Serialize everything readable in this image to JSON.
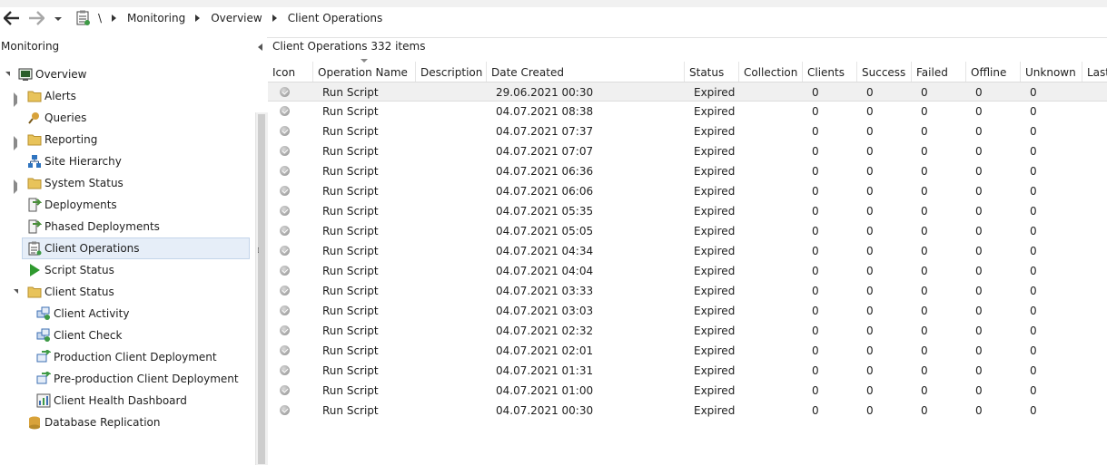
{
  "breadcrumb": {
    "root": "\\",
    "items": [
      "Monitoring",
      "Overview",
      "Client Operations"
    ]
  },
  "left": {
    "title": "Monitoring",
    "tree": [
      {
        "label": "Overview",
        "level": 0,
        "expander": "open",
        "icon": "overview-icon",
        "icon_color": "#2b5f2b"
      },
      {
        "label": "Alerts",
        "level": 1,
        "expander": "closed",
        "icon": "folder-icon",
        "icon_color": "#e8c35a"
      },
      {
        "label": "Queries",
        "level": 1,
        "expander": "none",
        "icon": "query-icon",
        "icon_color": "#d8a23a"
      },
      {
        "label": "Reporting",
        "level": 1,
        "expander": "closed",
        "icon": "folder-icon",
        "icon_color": "#e8c35a"
      },
      {
        "label": "Site Hierarchy",
        "level": 1,
        "expander": "none",
        "icon": "hierarchy-icon",
        "icon_color": "#2f74c0"
      },
      {
        "label": "System Status",
        "level": 1,
        "expander": "closed",
        "icon": "folder-icon",
        "icon_color": "#e8c35a"
      },
      {
        "label": "Deployments",
        "level": 1,
        "expander": "none",
        "icon": "deployment-icon",
        "icon_color": "#4a8f3a"
      },
      {
        "label": "Phased Deployments",
        "level": 1,
        "expander": "none",
        "icon": "phased-deployment-icon",
        "icon_color": "#4a8f3a"
      },
      {
        "label": "Client Operations",
        "level": 1,
        "expander": "none",
        "icon": "client-operations-icon",
        "icon_color": "#4a4a4a",
        "selected": true
      },
      {
        "label": "Script Status",
        "level": 1,
        "expander": "none",
        "icon": "play-icon",
        "icon_color": "#2f9a2f"
      },
      {
        "label": "Client Status",
        "level": 1,
        "expander": "open",
        "icon": "folder-icon",
        "icon_color": "#e8c35a"
      },
      {
        "label": "Client Activity",
        "level": 2,
        "expander": "none",
        "icon": "client-activity-icon",
        "icon_color": "#3d6fb3"
      },
      {
        "label": "Client Check",
        "level": 2,
        "expander": "none",
        "icon": "client-check-icon",
        "icon_color": "#3d6fb3"
      },
      {
        "label": "Production Client Deployment",
        "level": 2,
        "expander": "none",
        "icon": "client-deployment-icon",
        "icon_color": "#3e9a46"
      },
      {
        "label": "Pre-production Client Deployment",
        "level": 2,
        "expander": "none",
        "icon": "client-deployment-icon",
        "icon_color": "#3e9a46"
      },
      {
        "label": "Client Health Dashboard",
        "level": 2,
        "expander": "none",
        "icon": "dashboard-icon",
        "icon_color": "#3d6fb3"
      },
      {
        "label": "Database Replication",
        "level": 1,
        "expander": "none",
        "icon": "database-icon",
        "icon_color": "#d8a23a"
      }
    ]
  },
  "main": {
    "title": "Client Operations",
    "count": "332 items",
    "columns": [
      "Icon",
      "Operation Name",
      "Description",
      "Date Created",
      "Status",
      "Collection",
      "Clients",
      "Success",
      "Failed",
      "Offline",
      "Unknown",
      "Last"
    ],
    "rows": [
      {
        "op": "Run Script",
        "date": "29.06.2021 00:30",
        "status": "Expired",
        "clients": "0",
        "success": "0",
        "failed": "0",
        "offline": "0",
        "unknown": "0"
      },
      {
        "op": "Run Script",
        "date": "04.07.2021 08:38",
        "status": "Expired",
        "clients": "0",
        "success": "0",
        "failed": "0",
        "offline": "0",
        "unknown": "0"
      },
      {
        "op": "Run Script",
        "date": "04.07.2021 07:37",
        "status": "Expired",
        "clients": "0",
        "success": "0",
        "failed": "0",
        "offline": "0",
        "unknown": "0"
      },
      {
        "op": "Run Script",
        "date": "04.07.2021 07:07",
        "status": "Expired",
        "clients": "0",
        "success": "0",
        "failed": "0",
        "offline": "0",
        "unknown": "0"
      },
      {
        "op": "Run Script",
        "date": "04.07.2021 06:36",
        "status": "Expired",
        "clients": "0",
        "success": "0",
        "failed": "0",
        "offline": "0",
        "unknown": "0"
      },
      {
        "op": "Run Script",
        "date": "04.07.2021 06:06",
        "status": "Expired",
        "clients": "0",
        "success": "0",
        "failed": "0",
        "offline": "0",
        "unknown": "0"
      },
      {
        "op": "Run Script",
        "date": "04.07.2021 05:35",
        "status": "Expired",
        "clients": "0",
        "success": "0",
        "failed": "0",
        "offline": "0",
        "unknown": "0"
      },
      {
        "op": "Run Script",
        "date": "04.07.2021 05:05",
        "status": "Expired",
        "clients": "0",
        "success": "0",
        "failed": "0",
        "offline": "0",
        "unknown": "0"
      },
      {
        "op": "Run Script",
        "date": "04.07.2021 04:34",
        "status": "Expired",
        "clients": "0",
        "success": "0",
        "failed": "0",
        "offline": "0",
        "unknown": "0"
      },
      {
        "op": "Run Script",
        "date": "04.07.2021 04:04",
        "status": "Expired",
        "clients": "0",
        "success": "0",
        "failed": "0",
        "offline": "0",
        "unknown": "0"
      },
      {
        "op": "Run Script",
        "date": "04.07.2021 03:33",
        "status": "Expired",
        "clients": "0",
        "success": "0",
        "failed": "0",
        "offline": "0",
        "unknown": "0"
      },
      {
        "op": "Run Script",
        "date": "04.07.2021 03:03",
        "status": "Expired",
        "clients": "0",
        "success": "0",
        "failed": "0",
        "offline": "0",
        "unknown": "0"
      },
      {
        "op": "Run Script",
        "date": "04.07.2021 02:32",
        "status": "Expired",
        "clients": "0",
        "success": "0",
        "failed": "0",
        "offline": "0",
        "unknown": "0"
      },
      {
        "op": "Run Script",
        "date": "04.07.2021 02:01",
        "status": "Expired",
        "clients": "0",
        "success": "0",
        "failed": "0",
        "offline": "0",
        "unknown": "0"
      },
      {
        "op": "Run Script",
        "date": "04.07.2021 01:31",
        "status": "Expired",
        "clients": "0",
        "success": "0",
        "failed": "0",
        "offline": "0",
        "unknown": "0"
      },
      {
        "op": "Run Script",
        "date": "04.07.2021 01:00",
        "status": "Expired",
        "clients": "0",
        "success": "0",
        "failed": "0",
        "offline": "0",
        "unknown": "0"
      },
      {
        "op": "Run Script",
        "date": "04.07.2021 00:30",
        "status": "Expired",
        "clients": "0",
        "success": "0",
        "failed": "0",
        "offline": "0",
        "unknown": "0"
      }
    ]
  }
}
